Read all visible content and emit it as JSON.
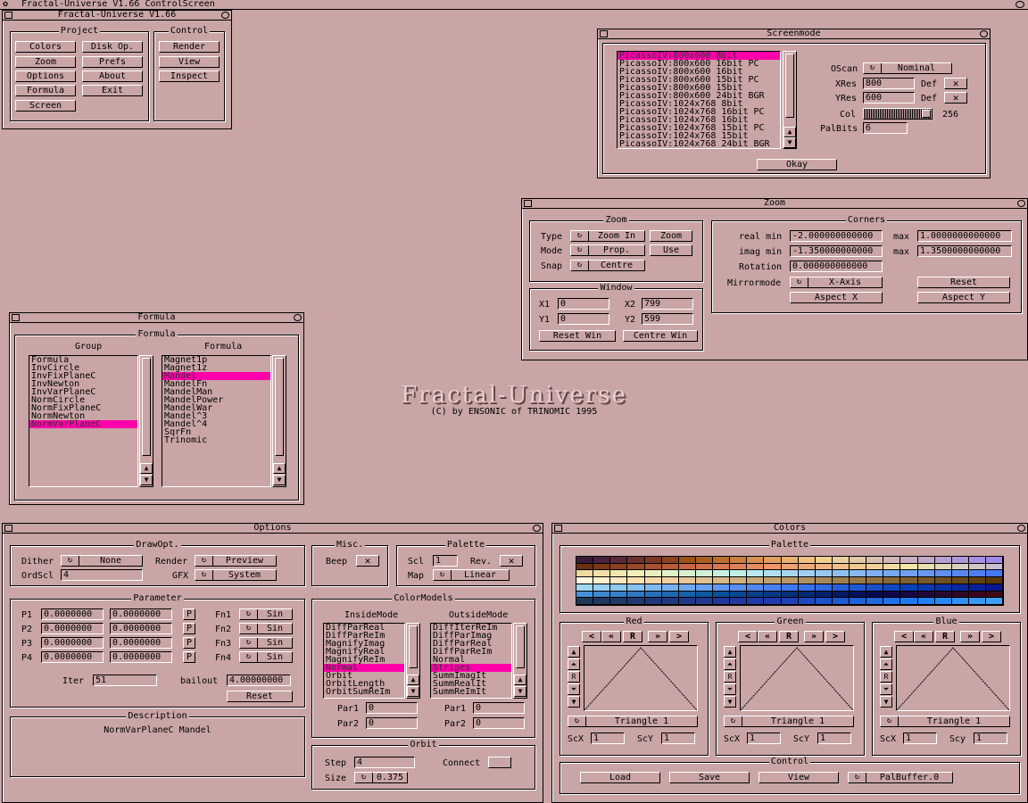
{
  "screen_title": "Fractal-Universe V1.66 ControlScreen",
  "main": {
    "title": "Fractal-Universe V1.66",
    "project_title": "Project",
    "control_title": "Control",
    "project_buttons": [
      "Colors",
      "Disk Op.",
      "Zoom",
      "Prefs",
      "Options",
      "About",
      "Formula",
      "Exit",
      "Screen"
    ],
    "control_buttons": [
      "Render",
      "View",
      "Inspect"
    ]
  },
  "screenmode": {
    "title": "Screenmode",
    "modes": [
      "PicassoIV:800x600  8bit",
      "PicassoIV:800x600 16bit PC",
      "PicassoIV:800x600 16bit",
      "PicassoIV:800x600 15bit PC",
      "PicassoIV:800x600 15bit",
      "PicassoIV:800x600 24bit BGR",
      "PicassoIV:1024x768  8bit",
      "PicassoIV:1024x768 16bit PC",
      "PicassoIV:1024x768 16bit",
      "PicassoIV:1024x768 15bit PC",
      "PicassoIV:1024x768 15bit",
      "PicassoIV:1024x768 24bit BGR"
    ],
    "selected_index": 0,
    "oscan_label": "OScan",
    "oscan_value": "Nominal",
    "xres_label": "XRes",
    "xres_value": "800",
    "yres_label": "YRes",
    "yres_value": "600",
    "def_label": "Def",
    "col_label": "Col",
    "col_value": "256",
    "palbits_label": "PalBits",
    "palbits_value": "6",
    "okay_label": "Okay"
  },
  "zoom": {
    "title": "Zoom",
    "zoom_group": "Zoom",
    "type_label": "Type",
    "type_value": "Zoom In",
    "mode_label": "Mode",
    "mode_value": "Prop.",
    "snap_label": "Snap",
    "snap_value": "Centre",
    "zoom_btn": "Zoom",
    "use_btn": "Use",
    "window_group": "Window",
    "x1_label": "X1",
    "x1_value": "0",
    "x2_label": "X2",
    "x2_value": "799",
    "y1_label": "Y1",
    "y1_value": "0",
    "y2_label": "Y2",
    "y2_value": "599",
    "reset_win": "Reset Win",
    "centre_win": "Centre Win",
    "corners_group": "Corners",
    "realmin_label": "real min",
    "realmin_value": "-2.000000000000",
    "max_label": "max",
    "realmax_value": "1.0000000000000",
    "imagmin_label": "imag min",
    "imagmin_value": "-1.350000000000",
    "imagmax_value": "1.3500000000000",
    "rotation_label": "Rotation",
    "rotation_value": "0.000000000000",
    "mirror_label": "Mirrormode",
    "mirror_value": "X-Axis",
    "reset_btn": "Reset",
    "aspectx_btn": "Aspect X",
    "aspecty_btn": "Aspect Y"
  },
  "formula": {
    "title": "Formula",
    "group_title": "Formula",
    "col_group": "Group",
    "col_formula": "Formula",
    "groups": [
      "Formula",
      "InvCircle",
      "InvFixPlaneC",
      "InvNewton",
      "InvVarPlaneC",
      "NormCircle",
      "NormFixPlaneC",
      "NormNewton",
      "NormVarPlaneC"
    ],
    "group_selected": 8,
    "formulas": [
      "Magnet1p",
      "Magnet1z",
      "Mandel",
      "MandelFn",
      "MandelMan",
      "MandelPower",
      "MandelWar",
      "Mandel^3",
      "Mandel^4",
      "SqrFn",
      "Trinomic"
    ],
    "formula_selected": 2
  },
  "logo": {
    "title": "Fractal-Universe",
    "credit": "(C) by ENSONIC of TRINOMIC 1995"
  },
  "options": {
    "title": "Options",
    "drawopt": "DrawOpt.",
    "dither_label": "Dither",
    "dither_value": "None",
    "render_label": "Render",
    "render_value": "Preview",
    "ordscl_label": "OrdScl",
    "ordscl_value": "4",
    "gfx_label": "GFX",
    "gfx_value": "System",
    "misc": "Misc.",
    "beep_label": "Beep",
    "palette": "Palette",
    "scl_label": "Scl",
    "scl_value": "1",
    "rev_label": "Rev.",
    "map_label": "Map",
    "map_value": "Linear",
    "parameter": "Parameter",
    "params": [
      {
        "label": "P1",
        "a": "0.0000000",
        "b": "0.0000000",
        "fn": "Fn1",
        "fv": "Sin"
      },
      {
        "label": "P2",
        "a": "0.0000000",
        "b": "0.0000000",
        "fn": "Fn2",
        "fv": "Sin"
      },
      {
        "label": "P3",
        "a": "0.0000000",
        "b": "0.0000000",
        "fn": "Fn3",
        "fv": "Sin"
      },
      {
        "label": "P4",
        "a": "0.0000000",
        "b": "0.0000000",
        "fn": "Fn4",
        "fv": "Sin"
      }
    ],
    "p_btn": "P",
    "iter_label": "Iter",
    "iter_value": "51",
    "bailout_label": "bailout",
    "bailout_value": "4.00000000",
    "reset_btn": "Reset",
    "description": "Description",
    "description_text": "NormVarPlaneC Mandel",
    "colormodels": "ColorModels",
    "inside_title": "InsideMode",
    "outside_title": "OutsideMode",
    "inside_list": [
      "DiffParReal",
      "DiffParReIm",
      "MagnifyImag",
      "MagnifyReal",
      "MagnifyReIm",
      "Normal",
      "Orbit",
      "OrbitLength",
      "OrbitSumReIm"
    ],
    "inside_selected": 5,
    "outside_list": [
      "DiffIterReIm",
      "DiffParImag",
      "DiffParReal",
      "DiffParReIm",
      "Normal",
      "Stripes",
      "SummImagIt",
      "SummRealIt",
      "SummReImIt"
    ],
    "outside_selected": 5,
    "par1_label": "Par1",
    "par2_label": "Par2",
    "in_par1": "0",
    "in_par2": "0",
    "out_par1": "0",
    "out_par2": "0",
    "orbit": "Orbit",
    "step_label": "Step",
    "step_value": "4",
    "connect_label": "Connect",
    "size_label": "Size",
    "size_value": "0.375"
  },
  "colors": {
    "title": "Colors",
    "palette": "Palette",
    "palette_rows": [
      [
        "#3a1a3a",
        "#4a2040",
        "#5a2838",
        "#6a3030",
        "#7a3828",
        "#8a4420",
        "#9a5018",
        "#a86020",
        "#b87030",
        "#c88040",
        "#d89050",
        "#e0a060",
        "#e8b070",
        "#f0c080",
        "#f0d090",
        "#e8d0a0",
        "#e0c8a8",
        "#d8c0b0",
        "#d0b8b8",
        "#c8b0c0",
        "#c0a8c8",
        "#b8a0d0",
        "#b098d8",
        "#a890e0",
        "#a088e8"
      ],
      [
        "#6a3010",
        "#7a3818",
        "#8a4020",
        "#9a4828",
        "#aa5030",
        "#ba5a38",
        "#ca6440",
        "#d06e48",
        "#d87850",
        "#e08258",
        "#e88c60",
        "#f09668",
        "#f0a070",
        "#f0aa78",
        "#f0b480",
        "#f0be88",
        "#f0c890",
        "#f0d298",
        "#f0dca0",
        "#f0e6a8",
        "#e8e0b0",
        "#e0d8b8",
        "#d8d0c0",
        "#d0c8c8",
        "#c8c0d0"
      ],
      [
        "#f0d8a0",
        "#f0e0a8",
        "#f0e8b0",
        "#f0f0b8",
        "#e8f0c0",
        "#e0f0c8",
        "#d8f0d0",
        "#d0f0d8",
        "#c8f0e0",
        "#c0f0e8",
        "#b8e8f0",
        "#b0e0f0",
        "#a8d8f0",
        "#a0d0f0",
        "#98c8f0",
        "#90c0f0",
        "#88b8f0",
        "#80b0f0",
        "#78a8f0",
        "#70a0f0",
        "#6898f0",
        "#6090f0",
        "#5888f0",
        "#5080f0",
        "#4878f0"
      ],
      [
        "#fff8e0",
        "#fff0d0",
        "#ffe8c0",
        "#ffe0b0",
        "#f8d8a8",
        "#f0d0a0",
        "#e8c898",
        "#e0c090",
        "#d8b888",
        "#d0b080",
        "#c8a878",
        "#c0a070",
        "#b89868",
        "#b09060",
        "#a88858",
        "#a08050",
        "#987848",
        "#907040",
        "#886838",
        "#806030",
        "#785828",
        "#705020",
        "#684818",
        "#604010",
        "#583808"
      ],
      [
        "#a0d8f0",
        "#98d0f0",
        "#90c8f0",
        "#88c0f0",
        "#80b8f0",
        "#78b0f0",
        "#70a8f0",
        "#68a0f0",
        "#6098f0",
        "#5890f0",
        "#5088f0",
        "#4880f0",
        "#4078f0",
        "#3870e8",
        "#3068e0",
        "#2860d8",
        "#2058d0",
        "#1850c8",
        "#1048c0",
        "#0840b8",
        "#0838b0",
        "#0830a8",
        "#0828a0",
        "#082098",
        "#081890"
      ],
      [
        "#4890d8",
        "#4088d0",
        "#3880c8",
        "#3078c0",
        "#2870b8",
        "#2068b0",
        "#1860a8",
        "#1058a0",
        "#085098",
        "#084890",
        "#084088",
        "#083880",
        "#083078",
        "#082870",
        "#082068",
        "#081860",
        "#081058",
        "#080850",
        "#100848",
        "#180840",
        "#200838",
        "#280830",
        "#300828",
        "#380820",
        "#400818"
      ],
      [
        "#203858",
        "#203860",
        "#203868",
        "#203870",
        "#203878",
        "#203880",
        "#203888",
        "#203890",
        "#203898",
        "#2038a0",
        "#2038a8",
        "#2038b0",
        "#2040b8",
        "#2048c0",
        "#2050c8",
        "#2058d0",
        "#2060d8",
        "#2068e0",
        "#2070e8",
        "#2078f0",
        "#2080f8",
        "#2888f8",
        "#3090f8",
        "#3898f8",
        "#40a0f8"
      ]
    ],
    "channels": [
      {
        "name": "Red",
        "func": "Triangle 1",
        "scx": "1",
        "scy": "1",
        "scy_label": "ScY"
      },
      {
        "name": "Green",
        "func": "Triangle 1",
        "scx": "1",
        "scy": "1",
        "scy_label": "ScY"
      },
      {
        "name": "Blue",
        "func": "Triangle 1",
        "scx": "1",
        "scy": "1",
        "scy_label": "Scy"
      }
    ],
    "nav": [
      "<",
      "«",
      "R",
      "»",
      ">"
    ],
    "scx_label": "ScX",
    "control": "Control",
    "load": "Load",
    "save": "Save",
    "view": "View",
    "palbuffer": "PalBuffer.0"
  }
}
